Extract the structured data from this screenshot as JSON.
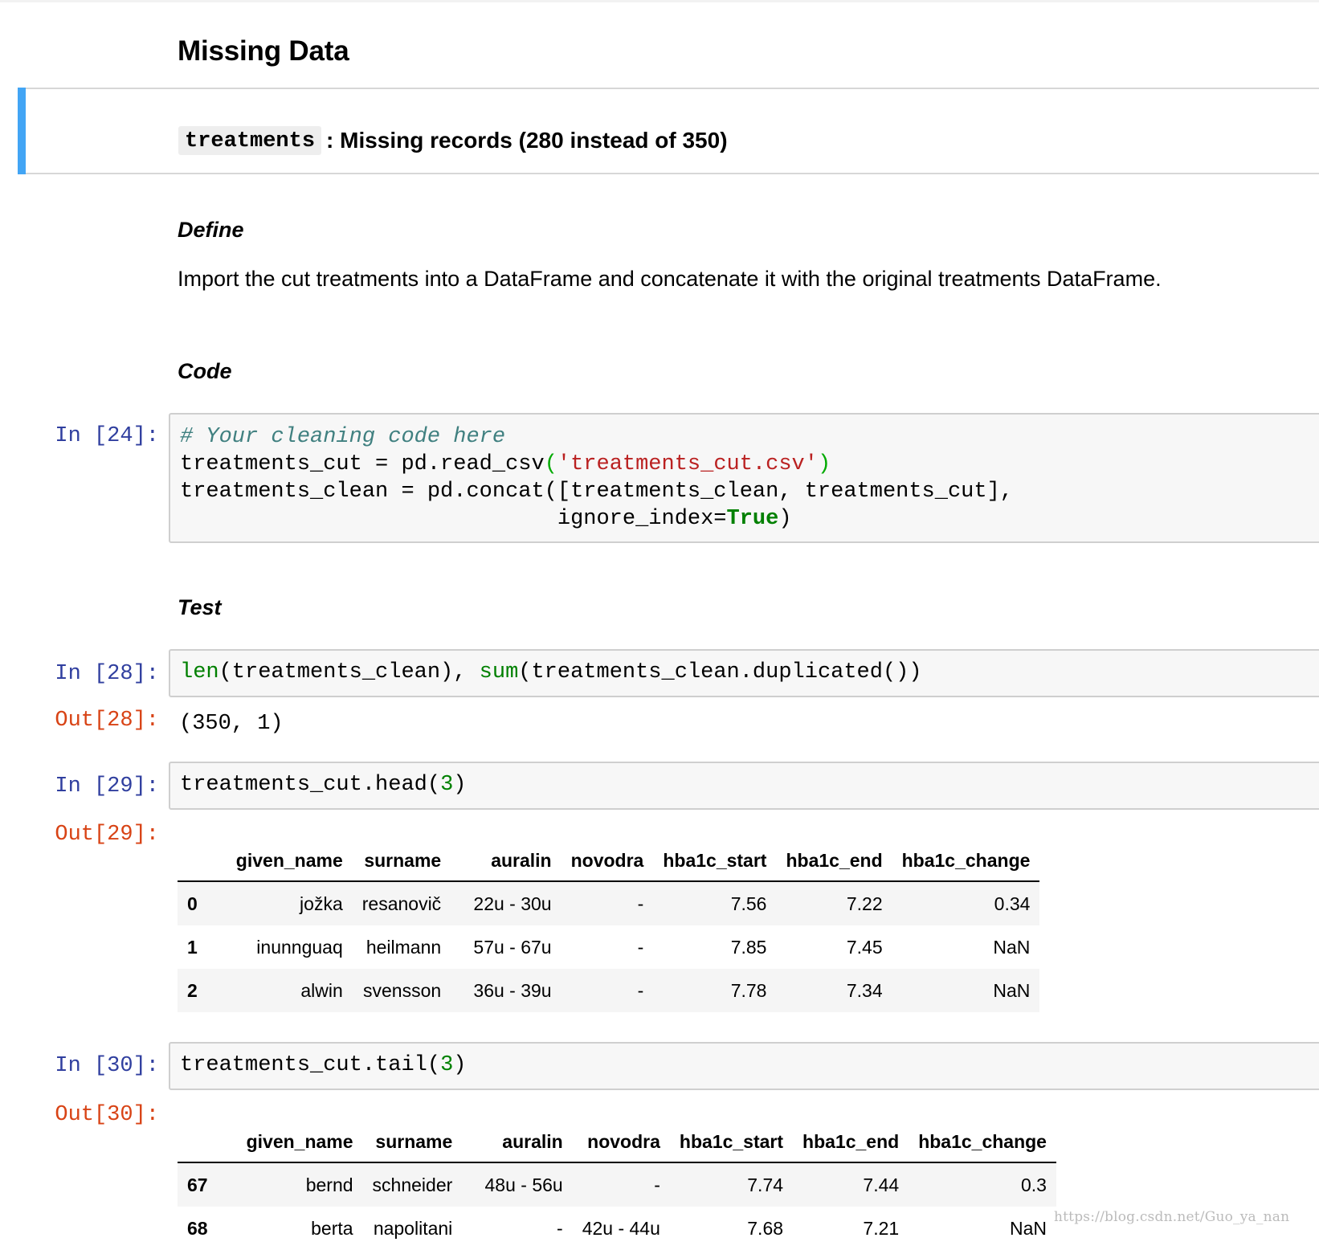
{
  "section_title": "Missing Data",
  "issue": {
    "code": "treatments",
    "text": ": Missing records (280 instead of 350)"
  },
  "define": {
    "heading": "Define",
    "text": "Import the cut treatments into a DataFrame and concatenate it with the original treatments DataFrame."
  },
  "code_heading": "Code",
  "test_heading": "Test",
  "cells": {
    "c24": {
      "prompt": "In [24]:",
      "comment": "# Your cleaning code here",
      "line2_a": "treatments_cut = pd.read_csv",
      "line2_paren_open": "(",
      "line2_str": "'treatments_cut.csv'",
      "line2_paren_close": ")",
      "line3": "treatments_clean = pd.concat([treatments_clean, treatments_cut],",
      "line4_a": "                             ignore_index=",
      "line4_kw": "True",
      "line4_b": ")"
    },
    "c28": {
      "prompt": "In [28]:",
      "fn1": "len",
      "mid": "(treatments_clean), ",
      "fn2": "sum",
      "tail": "(treatments_clean.duplicated())",
      "out_prompt": "Out[28]:",
      "out": "(350, 1)"
    },
    "c29": {
      "prompt": "In [29]:",
      "code_a": "treatments_cut.head(",
      "num": "3",
      "code_b": ")",
      "out_prompt": "Out[29]:"
    },
    "c30": {
      "prompt": "In [30]:",
      "code_a": "treatments_cut.tail(",
      "num": "3",
      "code_b": ")",
      "out_prompt": "Out[30]:"
    }
  },
  "table_columns": [
    "given_name",
    "surname",
    "auralin",
    "novodra",
    "hba1c_start",
    "hba1c_end",
    "hba1c_change"
  ],
  "head_rows": [
    {
      "idx": "0",
      "given_name": "jožka",
      "surname": "resanovič",
      "auralin": "22u - 30u",
      "novodra": "-",
      "hba1c_start": "7.56",
      "hba1c_end": "7.22",
      "hba1c_change": "0.34"
    },
    {
      "idx": "1",
      "given_name": "inunnguaq",
      "surname": "heilmann",
      "auralin": "57u - 67u",
      "novodra": "-",
      "hba1c_start": "7.85",
      "hba1c_end": "7.45",
      "hba1c_change": "NaN"
    },
    {
      "idx": "2",
      "given_name": "alwin",
      "surname": "svensson",
      "auralin": "36u - 39u",
      "novodra": "-",
      "hba1c_start": "7.78",
      "hba1c_end": "7.34",
      "hba1c_change": "NaN"
    }
  ],
  "tail_rows": [
    {
      "idx": "67",
      "given_name": "bernd",
      "surname": "schneider",
      "auralin": "48u - 56u",
      "novodra": "-",
      "hba1c_start": "7.74",
      "hba1c_end": "7.44",
      "hba1c_change": "0.3"
    },
    {
      "idx": "68",
      "given_name": "berta",
      "surname": "napolitani",
      "auralin": "-",
      "novodra": "42u - 44u",
      "hba1c_start": "7.68",
      "hba1c_end": "7.21",
      "hba1c_change": "NaN"
    }
  ],
  "watermark": "https://blog.csdn.net/Guo_ya_nan",
  "colors": {
    "selected_cell_bar": "#42a5f5",
    "in_prompt": "#303f9f",
    "out_prompt": "#d84315",
    "comment": "#408080",
    "string": "#ba2121",
    "builtin": "#008000"
  }
}
